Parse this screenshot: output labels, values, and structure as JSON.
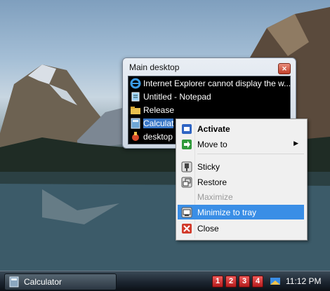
{
  "switcher": {
    "title": "Main desktop",
    "close_icon": "close-icon",
    "items": [
      {
        "label": "Internet Explorer cannot display the w...",
        "icon": "internet-explorer-icon"
      },
      {
        "label": "Untitled - Notepad",
        "icon": "notepad-icon"
      },
      {
        "label": "Release",
        "icon": "folder-icon"
      },
      {
        "label": "Calculat",
        "icon": "calculator-icon",
        "selected": true
      },
      {
        "label": "desktop",
        "icon": "desktop-app-icon"
      }
    ]
  },
  "menu": {
    "items": [
      {
        "label": "Activate",
        "icon": "activate-icon",
        "bold": true
      },
      {
        "label": "Move to",
        "icon": "move-to-icon",
        "submenu": true
      },
      {
        "label": "Sticky",
        "icon": "sticky-icon"
      },
      {
        "label": "Restore",
        "icon": "restore-icon"
      },
      {
        "label": "Maximize",
        "disabled": true
      },
      {
        "label": "Minimize to tray",
        "icon": "minimize-tray-icon",
        "highlighted": true
      },
      {
        "label": "Close",
        "icon": "close-red-icon"
      }
    ]
  },
  "taskbar": {
    "button_label": "Calculator",
    "virtual_desktops": [
      "1",
      "2",
      "3",
      "4"
    ],
    "clock": "11:12 PM"
  },
  "colors": {
    "highlight": "#3a8ee6",
    "selection": "#3a78c8",
    "desktop_badge": "#d42a2a"
  }
}
